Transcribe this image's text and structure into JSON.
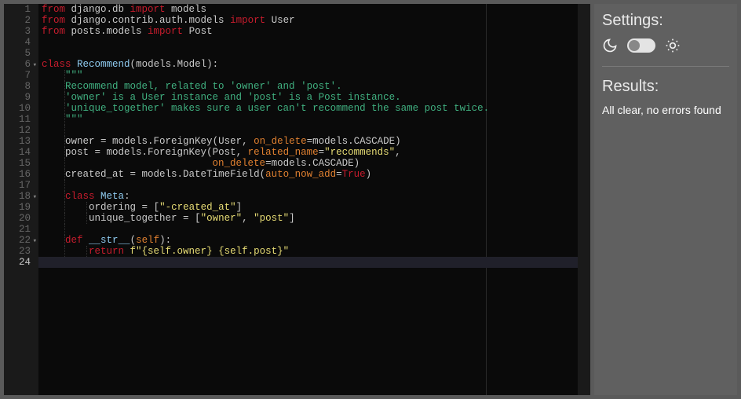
{
  "sidebar": {
    "settings_heading": "Settings:",
    "results_heading": "Results:",
    "results_text": "All clear, no errors found"
  },
  "editor": {
    "active_line": 24,
    "lines": [
      {
        "n": 1,
        "fold": false,
        "indent": 0,
        "tokens": [
          [
            "tk-kw",
            "from"
          ],
          [
            "tk-plain",
            " django.db "
          ],
          [
            "tk-kw",
            "import"
          ],
          [
            "tk-plain",
            " models"
          ]
        ]
      },
      {
        "n": 2,
        "fold": false,
        "indent": 0,
        "tokens": [
          [
            "tk-kw",
            "from"
          ],
          [
            "tk-plain",
            " django.contrib.auth.models "
          ],
          [
            "tk-kw",
            "import"
          ],
          [
            "tk-plain",
            " User"
          ]
        ]
      },
      {
        "n": 3,
        "fold": false,
        "indent": 0,
        "tokens": [
          [
            "tk-kw",
            "from"
          ],
          [
            "tk-plain",
            " posts.models "
          ],
          [
            "tk-kw",
            "import"
          ],
          [
            "tk-plain",
            " Post"
          ]
        ]
      },
      {
        "n": 4,
        "fold": false,
        "indent": 0,
        "tokens": []
      },
      {
        "n": 5,
        "fold": false,
        "indent": 0,
        "tokens": []
      },
      {
        "n": 6,
        "fold": true,
        "indent": 0,
        "tokens": [
          [
            "tk-kw2",
            "class"
          ],
          [
            "tk-plain",
            " "
          ],
          [
            "tk-def",
            "Recommend"
          ],
          [
            "tk-punc",
            "("
          ],
          [
            "tk-plain",
            "models.Model"
          ],
          [
            "tk-punc",
            "):"
          ]
        ]
      },
      {
        "n": 7,
        "fold": false,
        "indent": 1,
        "tokens": [
          [
            "tk-plain",
            "    "
          ],
          [
            "tk-strg",
            "\"\"\""
          ]
        ]
      },
      {
        "n": 8,
        "fold": false,
        "indent": 1,
        "tokens": [
          [
            "tk-plain",
            "    "
          ],
          [
            "tk-strg",
            "Recommend model, related to 'owner' and 'post'."
          ]
        ]
      },
      {
        "n": 9,
        "fold": false,
        "indent": 1,
        "tokens": [
          [
            "tk-plain",
            "    "
          ],
          [
            "tk-strg",
            "'owner' is a User instance and 'post' is a Post instance."
          ]
        ]
      },
      {
        "n": 10,
        "fold": false,
        "indent": 1,
        "tokens": [
          [
            "tk-plain",
            "    "
          ],
          [
            "tk-strg",
            "'unique_together' makes sure a user can't recommend the same post twice."
          ]
        ]
      },
      {
        "n": 11,
        "fold": false,
        "indent": 1,
        "tokens": [
          [
            "tk-plain",
            "    "
          ],
          [
            "tk-strg",
            "\"\"\""
          ]
        ]
      },
      {
        "n": 12,
        "fold": false,
        "indent": 1,
        "tokens": []
      },
      {
        "n": 13,
        "fold": false,
        "indent": 1,
        "tokens": [
          [
            "tk-plain",
            "    owner "
          ],
          [
            "tk-punc",
            "="
          ],
          [
            "tk-plain",
            " models.ForeignKey"
          ],
          [
            "tk-punc",
            "("
          ],
          [
            "tk-plain",
            "User"
          ],
          [
            "tk-punc",
            ", "
          ],
          [
            "tk-arg",
            "on_delete"
          ],
          [
            "tk-punc",
            "="
          ],
          [
            "tk-plain",
            "models.CASCADE"
          ],
          [
            "tk-punc",
            ")"
          ]
        ]
      },
      {
        "n": 14,
        "fold": false,
        "indent": 1,
        "tokens": [
          [
            "tk-plain",
            "    post "
          ],
          [
            "tk-punc",
            "="
          ],
          [
            "tk-plain",
            " models.ForeignKey"
          ],
          [
            "tk-punc",
            "("
          ],
          [
            "tk-plain",
            "Post"
          ],
          [
            "tk-punc",
            ", "
          ],
          [
            "tk-arg",
            "related_name"
          ],
          [
            "tk-punc",
            "="
          ],
          [
            "tk-str",
            "\"recommends\""
          ],
          [
            "tk-punc",
            ","
          ]
        ]
      },
      {
        "n": 15,
        "fold": false,
        "indent": 1,
        "tokens": [
          [
            "tk-plain",
            "                             "
          ],
          [
            "tk-arg",
            "on_delete"
          ],
          [
            "tk-punc",
            "="
          ],
          [
            "tk-plain",
            "models.CASCADE"
          ],
          [
            "tk-punc",
            ")"
          ]
        ]
      },
      {
        "n": 16,
        "fold": false,
        "indent": 1,
        "tokens": [
          [
            "tk-plain",
            "    created_at "
          ],
          [
            "tk-punc",
            "="
          ],
          [
            "tk-plain",
            " models.DateTimeField"
          ],
          [
            "tk-punc",
            "("
          ],
          [
            "tk-arg",
            "auto_now_add"
          ],
          [
            "tk-punc",
            "="
          ],
          [
            "tk-true",
            "True"
          ],
          [
            "tk-punc",
            ")"
          ]
        ]
      },
      {
        "n": 17,
        "fold": false,
        "indent": 1,
        "tokens": []
      },
      {
        "n": 18,
        "fold": true,
        "indent": 1,
        "tokens": [
          [
            "tk-plain",
            "    "
          ],
          [
            "tk-kw2",
            "class"
          ],
          [
            "tk-plain",
            " "
          ],
          [
            "tk-def",
            "Meta"
          ],
          [
            "tk-punc",
            ":"
          ]
        ]
      },
      {
        "n": 19,
        "fold": false,
        "indent": 2,
        "tokens": [
          [
            "tk-plain",
            "        ordering "
          ],
          [
            "tk-punc",
            "="
          ],
          [
            "tk-plain",
            " "
          ],
          [
            "tk-punc",
            "["
          ],
          [
            "tk-str",
            "\"-created_at\""
          ],
          [
            "tk-punc",
            "]"
          ]
        ]
      },
      {
        "n": 20,
        "fold": false,
        "indent": 2,
        "tokens": [
          [
            "tk-plain",
            "        unique_together "
          ],
          [
            "tk-punc",
            "="
          ],
          [
            "tk-plain",
            " "
          ],
          [
            "tk-punc",
            "["
          ],
          [
            "tk-str",
            "\"owner\""
          ],
          [
            "tk-punc",
            ", "
          ],
          [
            "tk-str",
            "\"post\""
          ],
          [
            "tk-punc",
            "]"
          ]
        ]
      },
      {
        "n": 21,
        "fold": false,
        "indent": 1,
        "tokens": []
      },
      {
        "n": 22,
        "fold": true,
        "indent": 1,
        "tokens": [
          [
            "tk-plain",
            "    "
          ],
          [
            "tk-kw2",
            "def"
          ],
          [
            "tk-plain",
            " "
          ],
          [
            "tk-def",
            "__str__"
          ],
          [
            "tk-punc",
            "("
          ],
          [
            "tk-self",
            "self"
          ],
          [
            "tk-punc",
            "):"
          ]
        ]
      },
      {
        "n": 23,
        "fold": false,
        "indent": 2,
        "tokens": [
          [
            "tk-plain",
            "        "
          ],
          [
            "tk-kw2",
            "return"
          ],
          [
            "tk-plain",
            " "
          ],
          [
            "tk-str",
            "f\"{self.owner} {self.post}\""
          ]
        ]
      },
      {
        "n": 24,
        "fold": false,
        "indent": 0,
        "tokens": []
      }
    ]
  }
}
